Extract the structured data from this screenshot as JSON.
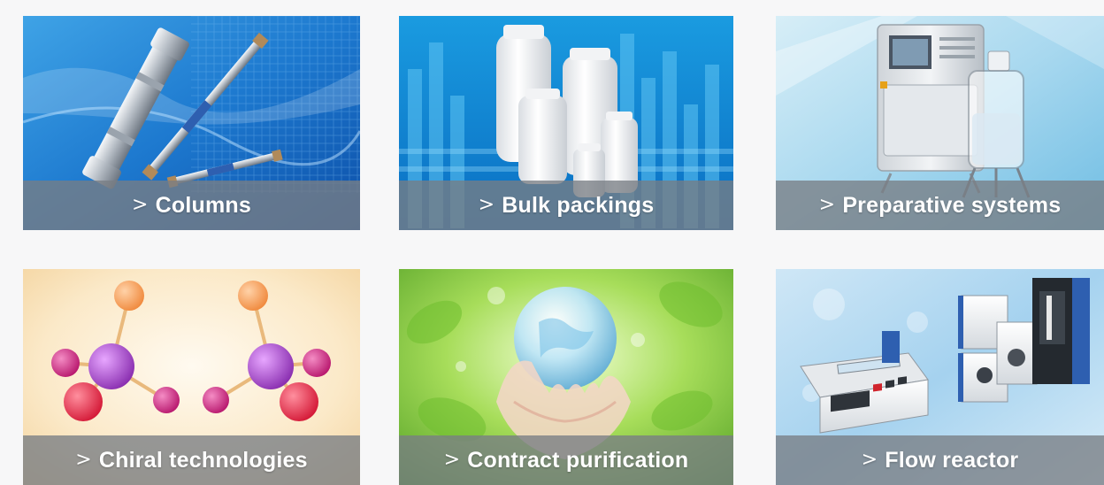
{
  "chevron": ">",
  "tiles": [
    {
      "label": "Columns"
    },
    {
      "label": "Bulk packings"
    },
    {
      "label": "Preparative systems"
    },
    {
      "label": "Chiral technologies"
    },
    {
      "label": "Contract purification"
    },
    {
      "label": "Flow reactor"
    }
  ],
  "colors": {
    "caption_bg": "#7d8288",
    "caption_text": "#ffffff",
    "page_bg": "#f7f7f8"
  },
  "images": [
    "hplc-columns-image",
    "bulk-packing-bottles-image",
    "preparative-system-image",
    "chiral-molecules-image",
    "hands-globe-image",
    "flow-reactor-equipment-image"
  ]
}
